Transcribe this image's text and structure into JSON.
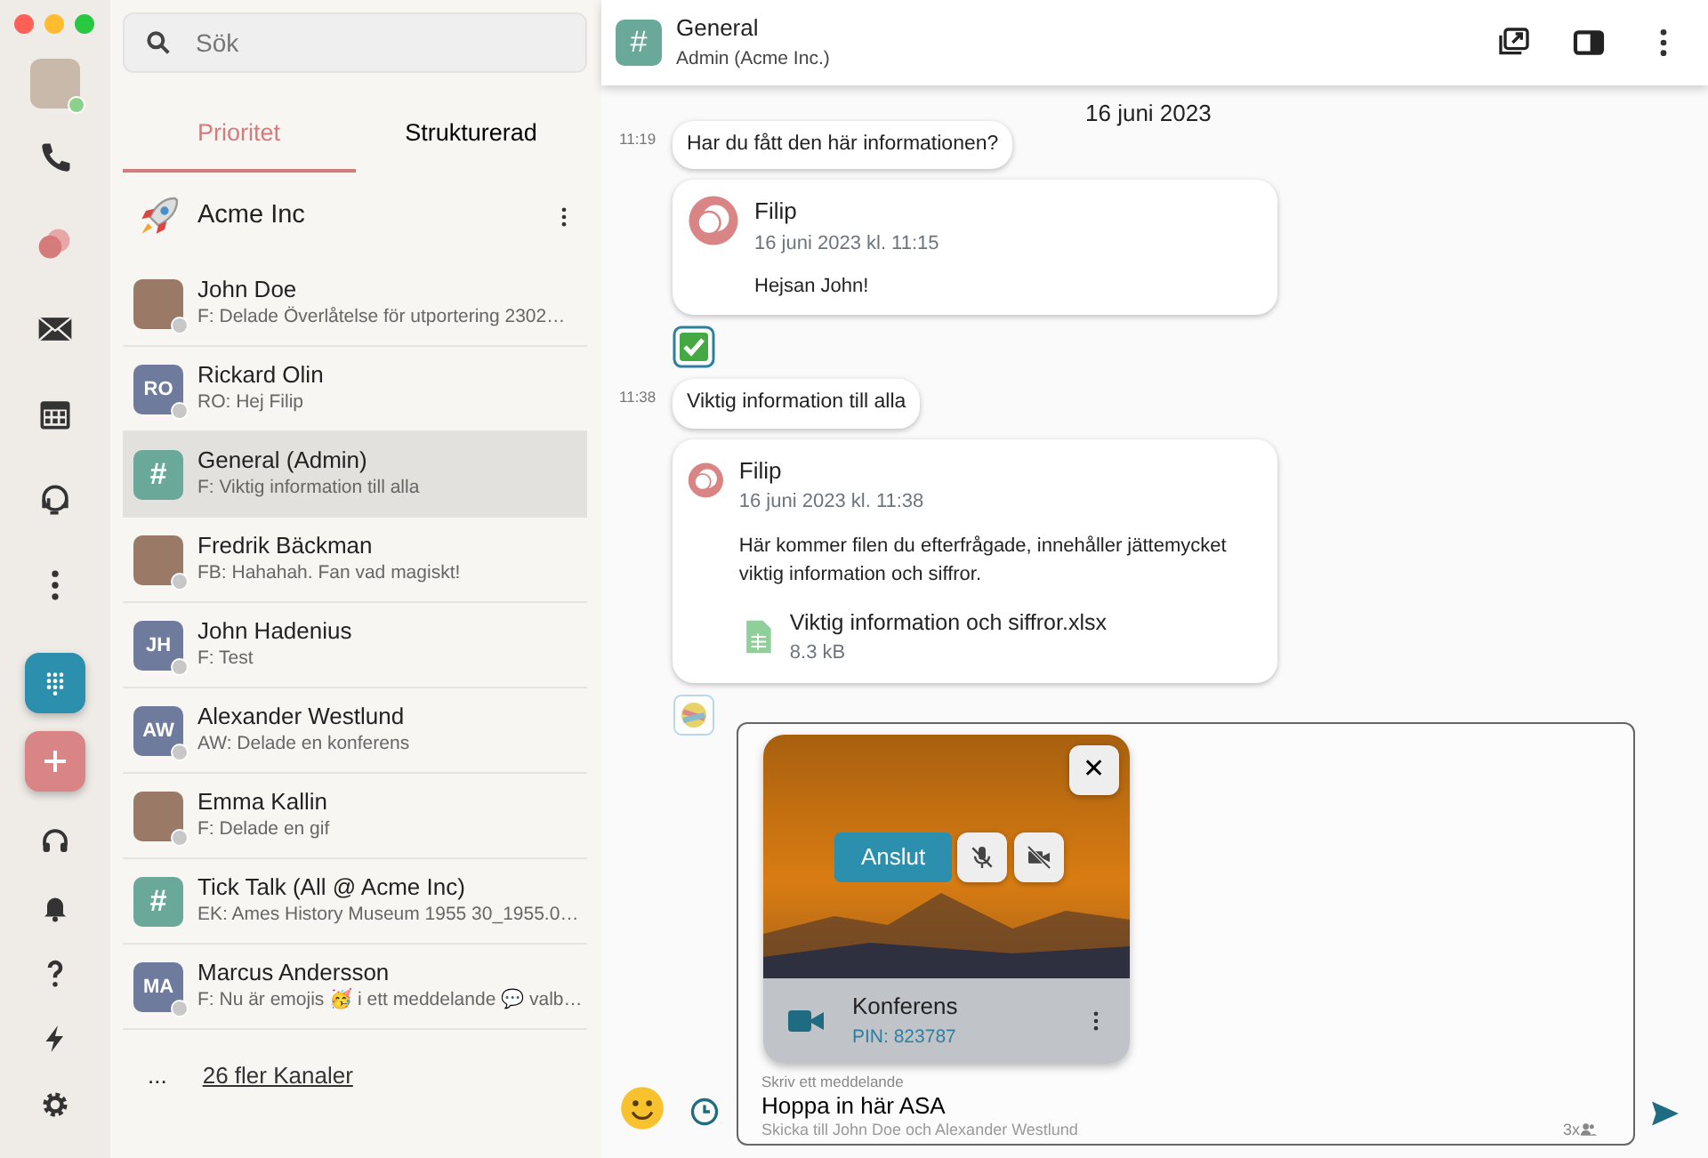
{
  "rail": {
    "items": [
      {
        "kind": "phone",
        "selected": false
      },
      {
        "kind": "chat",
        "selected": true
      },
      {
        "kind": "mail",
        "selected": false
      },
      {
        "kind": "calendar",
        "selected": false
      },
      {
        "kind": "support",
        "selected": false
      },
      {
        "kind": "more",
        "selected": false
      }
    ],
    "bottom": [
      {
        "kind": "headset"
      },
      {
        "kind": "bell"
      },
      {
        "kind": "help"
      },
      {
        "kind": "bolt"
      },
      {
        "kind": "gear"
      }
    ]
  },
  "sidebar": {
    "search": {
      "placeholder": "Sök"
    },
    "tabs": [
      {
        "label": "Prioritet",
        "selected": true
      },
      {
        "label": "Strukturerad",
        "selected": false
      }
    ],
    "org": "Acme Inc",
    "conversations": [
      {
        "name": "John Doe",
        "preview": "F: Delade Överlåtelse för utportering 2302…",
        "kind": "photo",
        "selected": false
      },
      {
        "name": "Rickard Olin",
        "preview": "RO: Hej Filip",
        "kind": "initials",
        "initials": "RO",
        "selected": false
      },
      {
        "name": "General (Admin)",
        "preview": "F: Viktig information till alla",
        "kind": "channel",
        "initials": "#",
        "selected": true
      },
      {
        "name": "Fredrik Bäckman",
        "preview": "FB: Hahahah. Fan vad magiskt!",
        "kind": "photo",
        "selected": false
      },
      {
        "name": "John Hadenius",
        "preview": "F: Test",
        "kind": "initials",
        "initials": "JH",
        "selected": false
      },
      {
        "name": "Alexander Westlund",
        "preview": "AW: Delade en konferens",
        "kind": "initials",
        "initials": "AW",
        "selected": false
      },
      {
        "name": "Emma Kallin",
        "preview": "F: Delade en gif",
        "kind": "photo",
        "selected": false
      },
      {
        "name": "Tick Talk (All @ Acme Inc)",
        "preview": "EK: Ames History Museum 1955 30_1955.0…",
        "kind": "channel",
        "initials": "#",
        "selected": false
      },
      {
        "name": "Marcus Andersson",
        "preview": "F: Nu är emojis 🥳 i ett meddelande 💬 valb…",
        "kind": "initials",
        "initials": "MA",
        "selected": false
      }
    ],
    "more_ellipsis": "...",
    "more_link": "26 fler Kanaler"
  },
  "chat": {
    "header": {
      "icon": "#",
      "title": "General",
      "subtitle": "Admin (Acme Inc.)"
    },
    "date": "16 juni 2023",
    "messages": [
      {
        "kind": "bubble",
        "time": "11:19",
        "text": "Har du fått den här informationen?"
      },
      {
        "kind": "quote",
        "author": "Filip",
        "timestamp": "16 juni 2023 kl. 11:15",
        "text": "Hejsan John!"
      },
      {
        "kind": "check"
      },
      {
        "kind": "bubble",
        "time": "11:38",
        "text": "Viktig information till alla"
      },
      {
        "kind": "quote",
        "author": "Filip",
        "timestamp": "16 juni 2023 kl. 11:38",
        "text": "Här kommer filen du efterfrågade, innehåller jättemycket viktig information och siffror.",
        "file": {
          "name": "Viktig information och siffror.xlsx",
          "size": "8.3 kB"
        }
      },
      {
        "kind": "sticker"
      }
    ],
    "composer": {
      "conference": {
        "join": "Anslut",
        "close": "✕",
        "title": "Konferens",
        "pin": "PIN: 823787"
      },
      "label": "Skriv ett meddelande",
      "value": "Hoppa in här ASA",
      "hint": "Skicka till John Doe och Alexander Westlund",
      "count": "3x"
    }
  }
}
